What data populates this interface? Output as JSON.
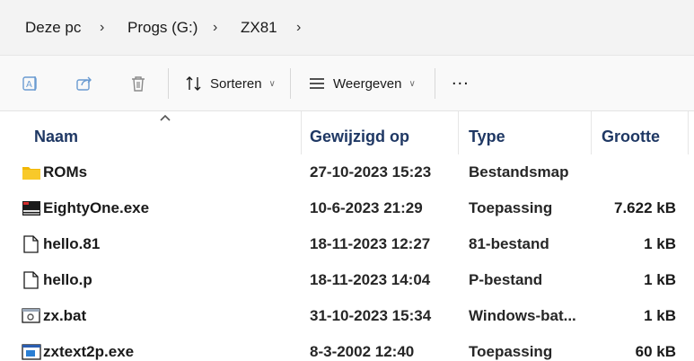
{
  "breadcrumb": [
    "Deze pc",
    "Progs (G:)",
    "ZX81"
  ],
  "toolbar": {
    "sort_label": "Sorteren",
    "view_label": "Weergeven",
    "more_label": "..."
  },
  "columns": {
    "name": "Naam",
    "modified": "Gewijzigd op",
    "type": "Type",
    "size": "Grootte"
  },
  "files": [
    {
      "name": "ROMs",
      "modified": "27-10-2023 15:23",
      "type": "Bestandsmap",
      "size": "",
      "icon": "folder-icon"
    },
    {
      "name": "EightyOne.exe",
      "modified": "10-6-2023 21:29",
      "type": "Toepassing",
      "size": "7.622 kB",
      "icon": "app-icon"
    },
    {
      "name": "hello.81",
      "modified": "18-11-2023 12:27",
      "type": "81-bestand",
      "size": "1 kB",
      "icon": "file-icon"
    },
    {
      "name": "hello.p",
      "modified": "18-11-2023 14:04",
      "type": "P-bestand",
      "size": "1 kB",
      "icon": "file-icon"
    },
    {
      "name": "zx.bat",
      "modified": "31-10-2023 15:34",
      "type": "Windows-bat...",
      "size": "1 kB",
      "icon": "batch-icon"
    },
    {
      "name": "zxtext2p.exe",
      "modified": "8-3-2002 12:40",
      "type": "Toepassing",
      "size": "60 kB",
      "icon": "exe-icon"
    }
  ],
  "colors": {
    "folder": "#f2b705",
    "header_text": "#1f3864",
    "accent": "#0067c0"
  }
}
